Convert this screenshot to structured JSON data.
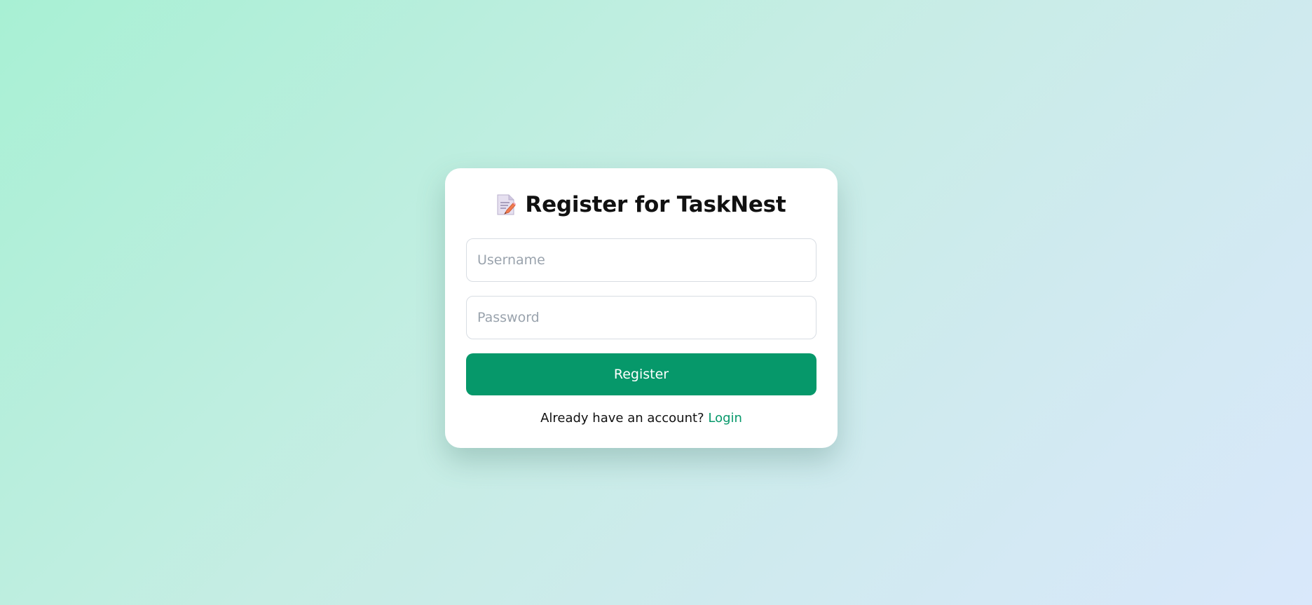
{
  "register_card": {
    "title": "Register for TaskNest",
    "title_icon": "memo-icon",
    "username": {
      "placeholder": "Username",
      "value": ""
    },
    "password": {
      "placeholder": "Password",
      "value": ""
    },
    "register_button_label": "Register",
    "footer_text": "Already have an account?",
    "login_link_label": "Login"
  },
  "colors": {
    "accent": "#06986a",
    "background_start": "#a8f0d4",
    "background_end": "#d9e8fb",
    "card": "#ffffff"
  }
}
